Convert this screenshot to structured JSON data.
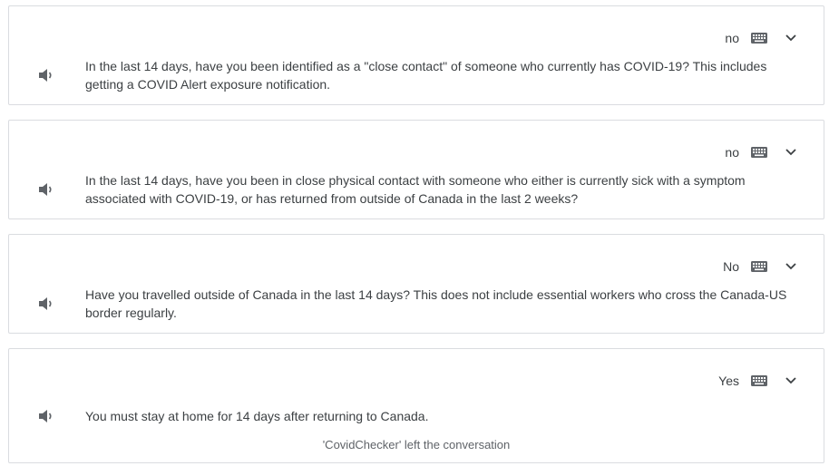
{
  "entries": [
    {
      "reply": "no",
      "question": "In the last 14 days, have you been identified as a \"close contact\" of someone who currently has COVID-19? This includes getting a COVID Alert exposure notification."
    },
    {
      "reply": "no",
      "question": "In the last 14 days, have you been in close physical contact with someone who either is currently sick with a symptom associated with COVID-19, or has returned from outside of Canada in the last 2 weeks?"
    },
    {
      "reply": "No",
      "question": "Have you travelled outside of Canada in the last 14 days? This does not include essential workers who cross the Canada-US border regularly."
    },
    {
      "reply": "Yes",
      "question": "You must stay at home for 14 days after returning to Canada."
    }
  ],
  "system_note": "'CovidChecker' left the conversation",
  "icons": {
    "speaker": "volume-icon",
    "keyboard": "keyboard-icon",
    "expand": "chevron-down-icon"
  },
  "colors": {
    "border": "#dadce0",
    "text": "#3c4043",
    "icon": "#5f6368"
  }
}
